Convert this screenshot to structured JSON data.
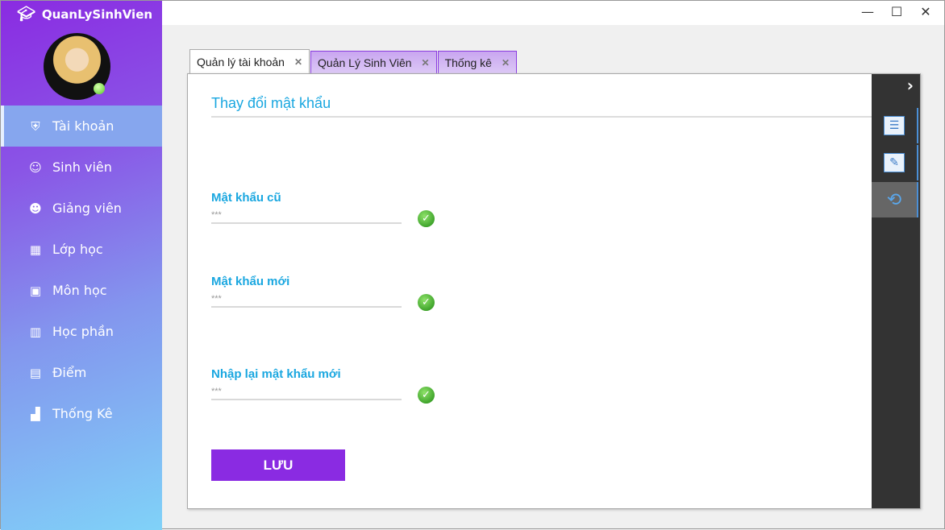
{
  "app": {
    "title": "QuanLySinhVien"
  },
  "sidebar": {
    "items": [
      {
        "label": "Tài khoản",
        "icon": "shield-user-icon",
        "active": true
      },
      {
        "label": "Sinh viên",
        "icon": "student-icon"
      },
      {
        "label": "Giảng viên",
        "icon": "teacher-icon"
      },
      {
        "label": "Lớp học",
        "icon": "classroom-icon"
      },
      {
        "label": "Môn học",
        "icon": "subject-icon"
      },
      {
        "label": "Học phần",
        "icon": "book-icon"
      },
      {
        "label": "Điểm",
        "icon": "score-icon"
      },
      {
        "label": "Thống Kê",
        "icon": "chart-icon"
      }
    ]
  },
  "tabs": [
    {
      "label": "Quản lý tài khoản",
      "active": true
    },
    {
      "label": "Quản Lý Sinh Viên"
    },
    {
      "label": "Thống kê"
    }
  ],
  "form": {
    "heading": "Thay đổi mật khẩu",
    "fields": [
      {
        "label": "Mật khẩu cũ",
        "value": "***"
      },
      {
        "label": "Mật khẩu mới",
        "value": "***"
      },
      {
        "label": "Nhập lại mật khẩu mới",
        "value": "***"
      }
    ],
    "save_label": "LƯU"
  },
  "colors": {
    "accent": "#8a2be2",
    "heading": "#1aa7e0",
    "rail": "#333333"
  }
}
